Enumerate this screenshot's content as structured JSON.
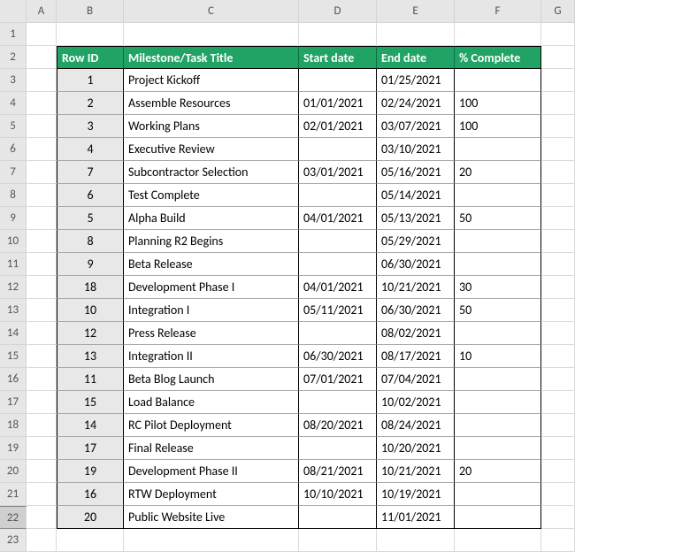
{
  "columns": [
    "",
    "A",
    "B",
    "C",
    "D",
    "E",
    "F",
    "G"
  ],
  "rows_count": 23,
  "selected_row": 22,
  "table": {
    "header": {
      "row_id": "Row ID",
      "title": "Milestone/Task Title",
      "start": "Start date",
      "end": "End date",
      "pct": "% Complete"
    },
    "rows": [
      {
        "id": "1",
        "title": "Project Kickoff",
        "start": "",
        "end": "01/25/2021",
        "pct": ""
      },
      {
        "id": "2",
        "title": "Assemble Resources",
        "start": "01/01/2021",
        "end": "02/24/2021",
        "pct": "100"
      },
      {
        "id": "3",
        "title": "Working Plans",
        "start": "02/01/2021",
        "end": "03/07/2021",
        "pct": "100"
      },
      {
        "id": "4",
        "title": "Executive Review",
        "start": "",
        "end": "03/10/2021",
        "pct": ""
      },
      {
        "id": "7",
        "title": "Subcontractor Selection",
        "start": "03/01/2021",
        "end": "05/16/2021",
        "pct": "20"
      },
      {
        "id": "6",
        "title": "Test Complete",
        "start": "",
        "end": "05/14/2021",
        "pct": ""
      },
      {
        "id": "5",
        "title": "Alpha Build",
        "start": "04/01/2021",
        "end": "05/13/2021",
        "pct": "50"
      },
      {
        "id": "8",
        "title": "Planning R2 Begins",
        "start": "",
        "end": "05/29/2021",
        "pct": ""
      },
      {
        "id": "9",
        "title": "Beta Release",
        "start": "",
        "end": "06/30/2021",
        "pct": ""
      },
      {
        "id": "18",
        "title": "Development Phase I",
        "start": "04/01/2021",
        "end": "10/21/2021",
        "pct": "30"
      },
      {
        "id": "10",
        "title": "Integration I",
        "start": "05/11/2021",
        "end": "06/30/2021",
        "pct": "50"
      },
      {
        "id": "12",
        "title": "Press Release",
        "start": "",
        "end": "08/02/2021",
        "pct": ""
      },
      {
        "id": "13",
        "title": "Integration II",
        "start": "06/30/2021",
        "end": "08/17/2021",
        "pct": "10"
      },
      {
        "id": "11",
        "title": "Beta Blog Launch",
        "start": "07/01/2021",
        "end": "07/04/2021",
        "pct": ""
      },
      {
        "id": "15",
        "title": "Load Balance",
        "start": "",
        "end": "10/02/2021",
        "pct": ""
      },
      {
        "id": "14",
        "title": "RC Pilot Deployment",
        "start": "08/20/2021",
        "end": "08/24/2021",
        "pct": ""
      },
      {
        "id": "17",
        "title": "Final Release",
        "start": "",
        "end": "10/20/2021",
        "pct": ""
      },
      {
        "id": "19",
        "title": "Development Phase II",
        "start": "08/21/2021",
        "end": "10/21/2021",
        "pct": "20"
      },
      {
        "id": "16",
        "title": "RTW Deployment",
        "start": "10/10/2021",
        "end": "10/19/2021",
        "pct": ""
      },
      {
        "id": "20",
        "title": "Public Website Live",
        "start": "",
        "end": "11/01/2021",
        "pct": ""
      }
    ]
  }
}
